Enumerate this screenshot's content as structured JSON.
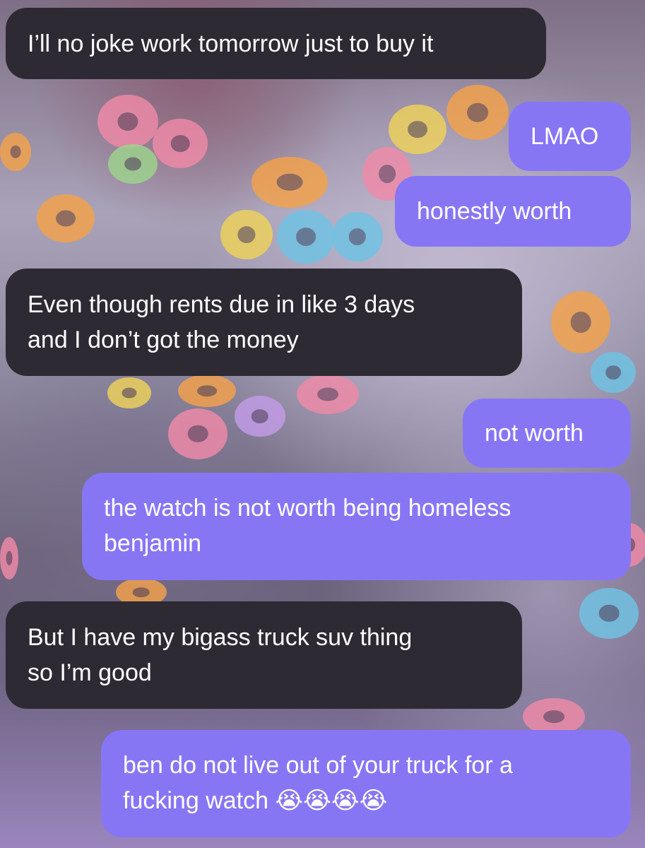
{
  "conversation": {
    "messages": [
      {
        "direction": "received",
        "lines": [
          "I’ll no joke work tomorrow just to buy it"
        ]
      },
      {
        "direction": "sent",
        "lines": [
          "LMAO"
        ]
      },
      {
        "direction": "sent",
        "lines": [
          "honestly worth"
        ]
      },
      {
        "direction": "received",
        "lines": [
          "Even though rents due in like 3 days",
          "and I don’t got the money"
        ]
      },
      {
        "direction": "sent",
        "lines": [
          "not worth"
        ]
      },
      {
        "direction": "sent",
        "lines": [
          "the watch is not worth being homeless",
          "benjamin"
        ]
      },
      {
        "direction": "received",
        "lines": [
          "But I have my bigass truck suv thing",
          "so I’m good"
        ]
      },
      {
        "direction": "sent",
        "lines": [
          "ben do not live out of your truck for a",
          "fucking watch 😭😭😭😭"
        ]
      }
    ]
  },
  "colors": {
    "received_bubble": "#2d2a34",
    "sent_bubble": "#8776f4",
    "bubble_text": "#ffffff"
  },
  "background": {
    "description_icons": [
      "cereal-loop-icon"
    ]
  }
}
